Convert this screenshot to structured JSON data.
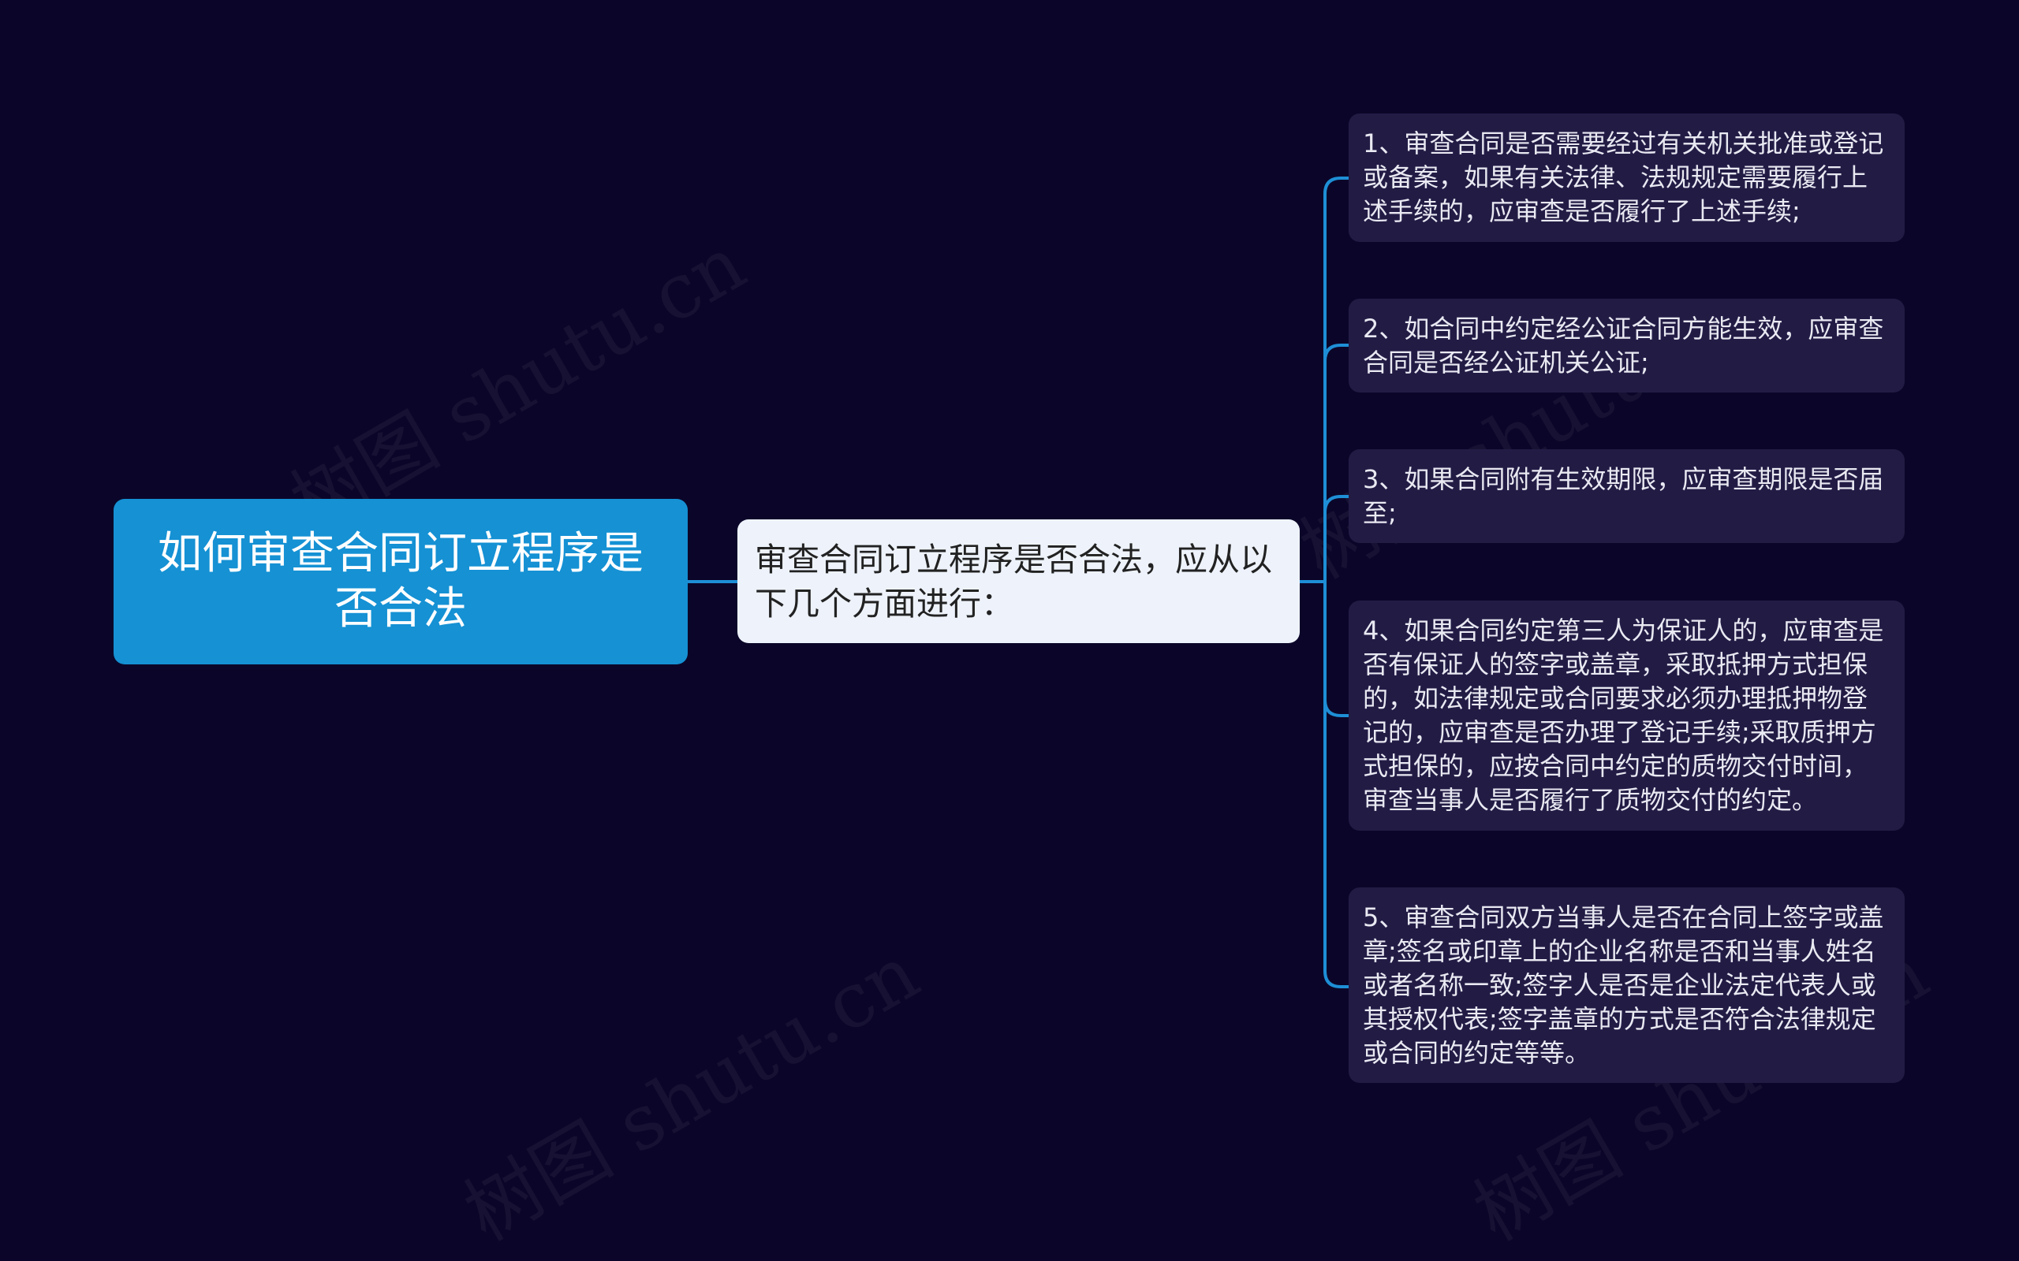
{
  "root": {
    "label": "如何审查合同订立程序是否合法"
  },
  "main_topic": {
    "label": "审查合同订立程序是否合法，应从以下几个方面进行："
  },
  "sub_topics": [
    {
      "label": "1、审查合同是否需要经过有关机关批准或登记或备案，如果有关法律、法规规定需要履行上述手续的，应审查是否履行了上述手续;"
    },
    {
      "label": "2、如合同中约定经公证合同方能生效，应审查合同是否经公证机关公证;"
    },
    {
      "label": "3、如果合同附有生效期限，应审查期限是否届至;"
    },
    {
      "label": "4、如果合同约定第三人为保证人的，应审查是否有保证人的签字或盖章，采取抵押方式担保的，如法律规定或合同要求必须办理抵押物登记的，应审查是否办理了登记手续;采取质押方式担保的，应按合同中约定的质物交付时间，审查当事人是否履行了质物交付的约定。"
    },
    {
      "label": "5、审查合同双方当事人是否在合同上签字或盖章;签名或印章上的企业名称是否和当事人姓名或者名称一致;签字人是否是企业法定代表人或其授权代表;签字盖章的方式是否符合法律规定或合同的约定等等。"
    }
  ],
  "watermark": {
    "text": "树图 shutu.cn"
  },
  "colors": {
    "background": "#0b0629",
    "root_fill": "#1591d4",
    "main_topic_fill": "#eef3fb",
    "sub_topic_fill": "#221c45",
    "connector": "#1e8fd6"
  }
}
